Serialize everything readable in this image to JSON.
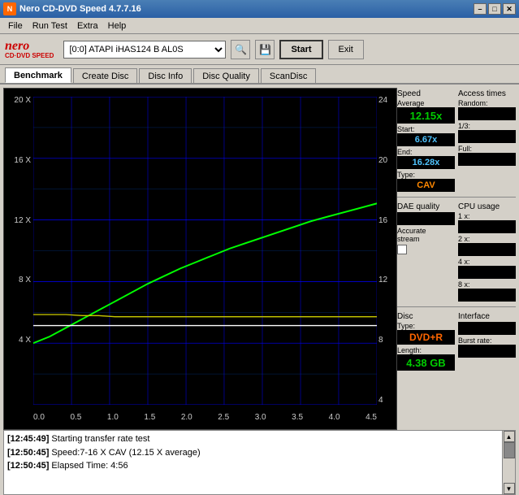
{
  "titleBar": {
    "title": "Nero CD-DVD Speed 4.7.7.16",
    "minimizeBtn": "–",
    "maximizeBtn": "□",
    "closeBtn": "✕"
  },
  "menu": {
    "items": [
      "File",
      "Run Test",
      "Extra",
      "Help"
    ]
  },
  "toolbar": {
    "logoTop": "nero",
    "logoBottom": "CD·DVD SPEED",
    "driveValue": "[0:0]  ATAPI iHAS124  B AL0S",
    "startLabel": "Start",
    "exitLabel": "Exit"
  },
  "tabs": [
    {
      "label": "Benchmark",
      "active": true
    },
    {
      "label": "Create Disc",
      "active": false
    },
    {
      "label": "Disc Info",
      "active": false
    },
    {
      "label": "Disc Quality",
      "active": false
    },
    {
      "label": "ScanDisc",
      "active": false
    }
  ],
  "chart": {
    "yLabelsLeft": [
      "20 X",
      "16 X",
      "12 X",
      "8 X",
      "4 X",
      ""
    ],
    "yLabelsRight": [
      "24",
      "20",
      "16",
      "12",
      "8",
      "4"
    ],
    "xLabels": [
      "0.0",
      "0.5",
      "1.0",
      "1.5",
      "2.0",
      "2.5",
      "3.0",
      "3.5",
      "4.0",
      "4.5"
    ]
  },
  "speedPanel": {
    "speedHeader": "Speed",
    "averageLabel": "Average",
    "averageValue": "12.15x",
    "startLabel": "Start:",
    "startValue": "6.67x",
    "endLabel": "End:",
    "endValue": "16.28x",
    "typeLabel": "Type:",
    "typeValue": "CAV"
  },
  "accessTimesPanel": {
    "header": "Access times",
    "randomLabel": "Random:",
    "randomValue": "",
    "oneThirdLabel": "1/3:",
    "oneThirdValue": "",
    "fullLabel": "Full:",
    "fullValue": ""
  },
  "cpuPanel": {
    "header": "CPU usage",
    "1xLabel": "1 x:",
    "1xValue": "",
    "2xLabel": "2 x:",
    "2xValue": "",
    "4xLabel": "4 x:",
    "4xValue": "",
    "8xLabel": "8 x:",
    "8xValue": ""
  },
  "daePanel": {
    "header": "DAE quality",
    "value": "",
    "accurateStreamLabel": "Accurate",
    "accurateStreamLabel2": "stream"
  },
  "discPanel": {
    "typeHeader": "Disc",
    "typeLabel": "Type:",
    "typeValue": "DVD+R",
    "lengthLabel": "Length:",
    "lengthValue": "4.38 GB"
  },
  "interfacePanel": {
    "header": "Interface",
    "burstLabel": "Burst rate:"
  },
  "log": {
    "lines": [
      {
        "time": "[12:45:49]",
        "text": "Starting transfer rate test"
      },
      {
        "time": "[12:50:45]",
        "text": "Speed:7-16 X CAV (12.15 X average)"
      },
      {
        "time": "[12:50:45]",
        "text": "Elapsed Time: 4:56"
      }
    ]
  }
}
